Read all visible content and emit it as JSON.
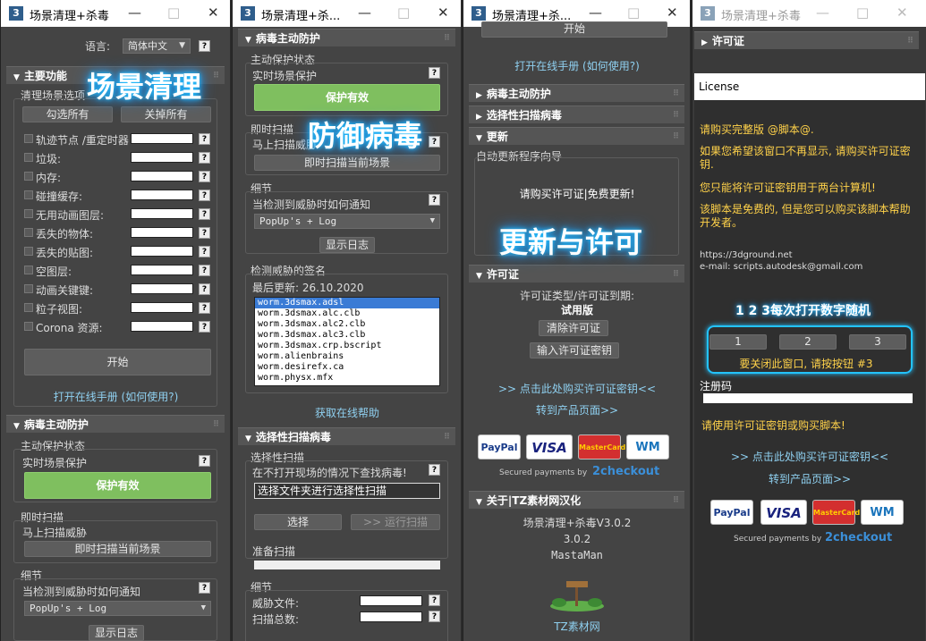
{
  "titlebar": {
    "title_full": "场景清理+杀毒",
    "title_short": "场景清理+杀...",
    "logo": "3",
    "min": "—",
    "max": "□",
    "close": "✕"
  },
  "overlays": {
    "scene_cleanup": "场景清理",
    "defend_virus": "防御病毒",
    "update_license": "更新与许可",
    "random_hint": "1 2 3每次打开数字随机"
  },
  "w1": {
    "lang_label": "语言:",
    "lang_value": "简体中文",
    "main_title": "主要功能",
    "cleanup_options": "清理场景选项",
    "check_all": "勾选所有",
    "uncheck_all": "关掉所有",
    "items": [
      "轨迹节点 /重定时器",
      "垃圾:",
      "内存:",
      "碰撞缓存:",
      "无用动画图层:",
      "丢失的物体:",
      "丢失的贴图:",
      "空图层:",
      "动画关键键:",
      "粒子视图:",
      "Corona 资源:"
    ],
    "start": "开始",
    "manual": "打开在线手册 (如何使用?)",
    "virus_title": "病毒主动防护",
    "status_label": "主动保护状态",
    "realtime": "实时场景保护",
    "protect_on": "保护有效",
    "instant_scan": "即时扫描",
    "scan_threat": "马上扫描威胁",
    "scan_now": "即时扫描当前场景",
    "details": "细节",
    "notify": "当检测到威胁时如何通知",
    "notify_value": "PopUp's + Log",
    "show_log": "显示日志"
  },
  "w2": {
    "virus_title": "病毒主动防护",
    "status_label": "主动保护状态",
    "realtime": "实时场景保护",
    "protect_on": "保护有效",
    "instant_scan": "即时扫描",
    "scan_threat": "马上扫描威胁",
    "scan_now": "即时扫描当前场景",
    "details": "细节",
    "notify": "当检测到威胁时如何通知",
    "notify_value": "PopUp's + Log",
    "show_log": "显示日志",
    "sig_title": "检测威胁的签名",
    "last_update": "最后更新: 26.10.2020",
    "signatures": [
      "worm.3dsmax.adsl",
      "worm.3dsmax.alc.clb",
      "worm.3dsmax.alc2.clb",
      "worm.3dsmax.alc3.clb",
      "worm.3dsmax.crp.bscript",
      "worm.alienbrains",
      "worm.desirefx.ca",
      "worm.physx.mfx"
    ],
    "get_help": "获取在线帮助",
    "selective_title": "选择性扫描病毒",
    "selective_label": "选择性扫描",
    "selective_desc": "在不打开现场的情况下查找病毒!",
    "selective_folder": "选择文件夹进行选择性扫描",
    "select": "选择",
    "run_scan": ">> 运行扫描",
    "prepare_scan": "准备扫描",
    "details2": "细节",
    "threat_files": "威胁文件:",
    "scan_total": "扫描总数:"
  },
  "w3": {
    "top_btn": "开始",
    "manual": "打开在线手册 (如何使用?)",
    "virus_title": "病毒主动防护",
    "selective_title": "选择性扫描病毒",
    "update_title": "更新",
    "auto_update": "自动更新程序向导",
    "buy_free": "请购买许可证|免费更新!",
    "license_title": "许可证",
    "license_type": "许可证类型/许可证到期:",
    "trial": "试用版",
    "clear_license": "清除许可证",
    "enter_key": "输入许可证密钥",
    "buy_link": ">> 点击此处购买许可证密钥<<",
    "product_page": "转到产品页面>>",
    "paypal": "PayPal",
    "visa": "VISA",
    "mastercard": "MasterCard",
    "webmoney": "WM",
    "secured_by": "Secured payments by",
    "checkout": "2checkout",
    "about_title": "关于|TZ素材网汉化",
    "about_name": "场景清理+杀毒V3.0.2",
    "about_version": "3.0.2",
    "about_author": "MastaMan",
    "about_site": "TZ素材网"
  },
  "w4": {
    "license_title": "许可证",
    "license_header": "License",
    "buy_full": "请购买完整版 @脚本@.",
    "info1": "如果您希望该窗口不再显示, 请购买许可证密钥.",
    "info2": "您只能将许可证密钥用于两台计算机!",
    "info3": "该脚本是免费的, 但是您可以购买该脚本帮助开发者。",
    "url": "https://3dground.net",
    "email": "e-mail: scripts.autodesk@gmail.com",
    "btn1": "1",
    "btn2": "2",
    "btn3": "3",
    "close_hint": "要关闭此窗口, 请按按钮 #3",
    "reg_code": "注册码",
    "use_key": "请使用许可证密钥或购买脚本!",
    "buy_link": ">> 点击此处购买许可证密钥<<",
    "product_page": "转到产品页面>>",
    "paypal": "PayPal",
    "visa": "VISA",
    "mastercard": "MasterCard",
    "webmoney": "WM",
    "secured_by": "Secured payments by",
    "checkout": "2checkout"
  },
  "colors": {
    "panel": "#444444",
    "rollout_header": "#555555",
    "green": "#7fbf5f",
    "link": "#8fd0f0",
    "glow": "#23c3ff"
  }
}
